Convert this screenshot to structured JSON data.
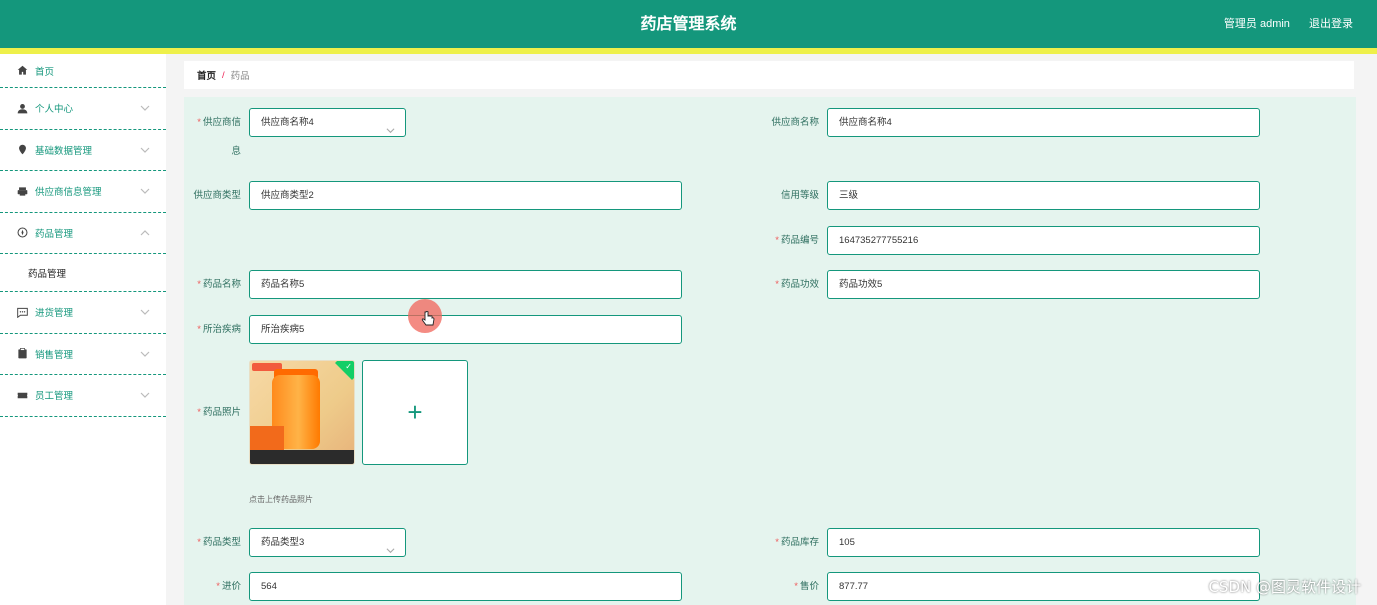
{
  "header": {
    "title": "药店管理系统",
    "user": "管理员 admin",
    "logout": "退出登录",
    "bg_color": "#14977c",
    "line_color": "#eef04a"
  },
  "sidebar": {
    "items": [
      {
        "label": "首页",
        "icon": "home-icon"
      },
      {
        "label": "个人中心",
        "icon": "user-icon"
      },
      {
        "label": "基础数据管理",
        "icon": "location-icon"
      },
      {
        "label": "供应商信息管理",
        "icon": "printer-icon"
      },
      {
        "label": "药品管理",
        "icon": "compass-icon"
      },
      {
        "label": "药品管理",
        "icon": ""
      },
      {
        "label": "进货管理",
        "icon": "message-icon"
      },
      {
        "label": "销售管理",
        "icon": "clipboard-icon"
      },
      {
        "label": "员工管理",
        "icon": "ticket-icon"
      }
    ]
  },
  "breadcrumb": {
    "home": "首页",
    "separator": "/",
    "current": "药品"
  },
  "form": {
    "supplier_info": {
      "label": "供应商信息",
      "value": "供应商名称4"
    },
    "supplier_name": {
      "label": "供应商名称",
      "value": "供应商名称4"
    },
    "supplier_type": {
      "label": "供应商类型",
      "value": "供应商类型2"
    },
    "credit_level": {
      "label": "信用等级",
      "value": "三级"
    },
    "drug_no": {
      "label": "药品编号",
      "value": "164735277755216"
    },
    "drug_name": {
      "label": "药品名称",
      "value": "药品名称5"
    },
    "drug_effect": {
      "label": "药品功效",
      "value": "药品功效5"
    },
    "disease": {
      "label": "所治疾病",
      "value": "所治疾病5"
    },
    "photo": {
      "label": "药品照片",
      "hint": "点击上传药品照片",
      "upload_symbol": "+"
    },
    "drug_type": {
      "label": "药品类型",
      "value": "药品类型3"
    },
    "stock": {
      "label": "药品库存",
      "value": "105"
    },
    "cost": {
      "label": "进价",
      "value": "564"
    },
    "price": {
      "label": "售价",
      "value": "877.77"
    }
  },
  "watermark": "CSDN @图灵软件设计"
}
